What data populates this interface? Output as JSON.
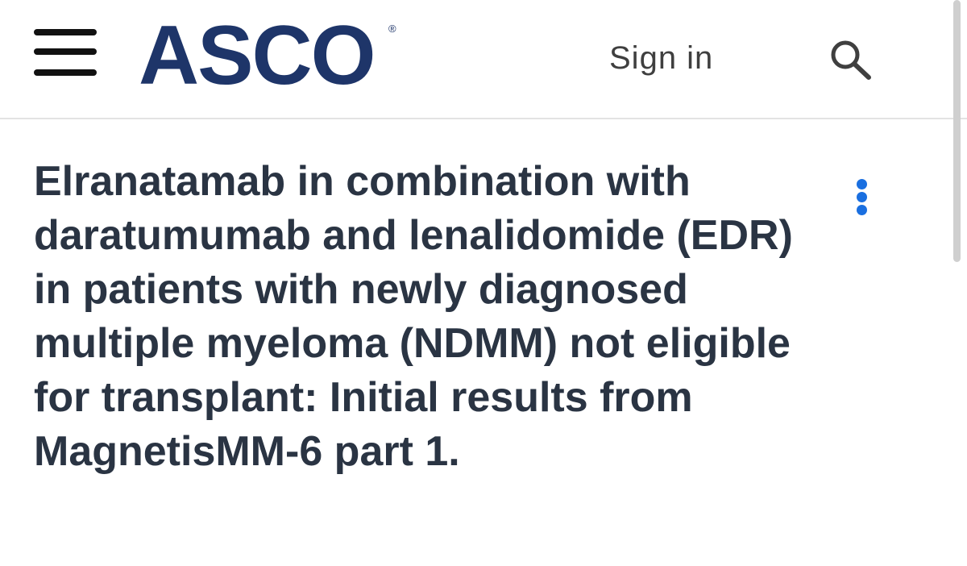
{
  "header": {
    "logo_text": "ASCO",
    "logo_registered_mark": "®",
    "sign_in_label": "Sign in",
    "icons": {
      "menu": "hamburger-menu-icon",
      "search": "search-icon"
    }
  },
  "article": {
    "title": "Elranatamab in combination with daratumumab and lenalidomide (EDR) in patients with newly diagnosed multiple myeloma (NDMM) not eligible for transplant: Initial results from MagnetisMM-6 part 1.",
    "more_options_icon": "vertical-dots-icon"
  },
  "colors": {
    "brand_navy": "#1e3569",
    "title_text": "#2a3443",
    "accent_blue": "#1a6fe0",
    "sign_in_text": "#3f3f3f"
  }
}
